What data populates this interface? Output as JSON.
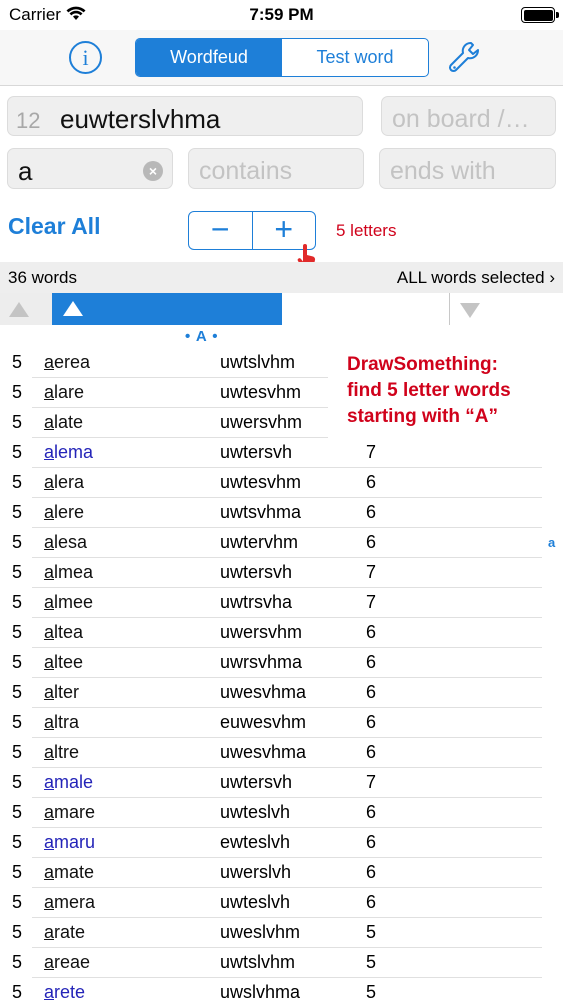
{
  "status": {
    "carrier": "Carrier",
    "time": "7:59 PM",
    "battery_level": 1.0
  },
  "toolbar": {
    "info_icon": "info-circle-icon",
    "segments": [
      {
        "label": "Wordfeud",
        "active": true
      },
      {
        "label": "Test word",
        "active": false
      }
    ],
    "settings_icon": "wrench-icon"
  },
  "inputs": {
    "letters_count": "12",
    "letters_value": "euwterslvhma",
    "board_placeholder": "on board /…",
    "starts_with_value": "a",
    "contains_placeholder": "contains",
    "ends_with_placeholder": "ends with"
  },
  "controls": {
    "clear_all": "Clear All",
    "minus": "−",
    "plus": "+",
    "length_label": "5 letters"
  },
  "summary": {
    "count": "36 words",
    "selection": "ALL words selected",
    "chevron": "›"
  },
  "section_marker": "• A •",
  "index_letter": "a",
  "annotation": {
    "line1": "DrawSomething:",
    "line2": "find 5 letter words",
    "line3": "starting with “A”"
  },
  "colors": {
    "accent": "#1e7fd8",
    "annotation": "#d0021b",
    "link_word": "#2424b8"
  },
  "words": [
    {
      "len": "5",
      "first": "a",
      "rest": "erea",
      "left": "uwtslvhm",
      "score": "",
      "link": false
    },
    {
      "len": "5",
      "first": "a",
      "rest": "lare",
      "left": "uwtesvhm",
      "score": "",
      "link": false
    },
    {
      "len": "5",
      "first": "a",
      "rest": "late",
      "left": "uwersvhm",
      "score": "",
      "link": false
    },
    {
      "len": "5",
      "first": "a",
      "rest": "lema",
      "left": "uwtersvh",
      "score": "7",
      "link": true
    },
    {
      "len": "5",
      "first": "a",
      "rest": "lera",
      "left": "uwtesvhm",
      "score": "6",
      "link": false
    },
    {
      "len": "5",
      "first": "a",
      "rest": "lere",
      "left": "uwtsvhma",
      "score": "6",
      "link": false
    },
    {
      "len": "5",
      "first": "a",
      "rest": "lesa",
      "left": "uwtervhm",
      "score": "6",
      "link": false
    },
    {
      "len": "5",
      "first": "a",
      "rest": "lmea",
      "left": "uwtersvh",
      "score": "7",
      "link": false
    },
    {
      "len": "5",
      "first": "a",
      "rest": "lmee",
      "left": "uwtrsvha",
      "score": "7",
      "link": false
    },
    {
      "len": "5",
      "first": "a",
      "rest": "ltea",
      "left": "uwersvhm",
      "score": "6",
      "link": false
    },
    {
      "len": "5",
      "first": "a",
      "rest": "ltee",
      "left": "uwrsvhma",
      "score": "6",
      "link": false
    },
    {
      "len": "5",
      "first": "a",
      "rest": "lter",
      "left": "uwesvhma",
      "score": "6",
      "link": false
    },
    {
      "len": "5",
      "first": "a",
      "rest": "ltra",
      "left": "euwesvhm",
      "score": "6",
      "link": false
    },
    {
      "len": "5",
      "first": "a",
      "rest": "ltre",
      "left": "uwesvhma",
      "score": "6",
      "link": false
    },
    {
      "len": "5",
      "first": "a",
      "rest": "male",
      "left": "uwtersvh",
      "score": "7",
      "link": true
    },
    {
      "len": "5",
      "first": "a",
      "rest": "mare",
      "left": "uwteslvh",
      "score": "6",
      "link": false
    },
    {
      "len": "5",
      "first": "a",
      "rest": "maru",
      "left": "ewteslvh",
      "score": "6",
      "link": true
    },
    {
      "len": "5",
      "first": "a",
      "rest": "mate",
      "left": "uwerslvh",
      "score": "6",
      "link": false
    },
    {
      "len": "5",
      "first": "a",
      "rest": "mera",
      "left": "uwteslvh",
      "score": "6",
      "link": false
    },
    {
      "len": "5",
      "first": "a",
      "rest": "rate",
      "left": "uweslvhm",
      "score": "5",
      "link": false
    },
    {
      "len": "5",
      "first": "a",
      "rest": "reae",
      "left": "uwtslvhm",
      "score": "5",
      "link": false
    },
    {
      "len": "5",
      "first": "a",
      "rest": "rete",
      "left": "uwslvhma",
      "score": "5",
      "link": true
    }
  ]
}
